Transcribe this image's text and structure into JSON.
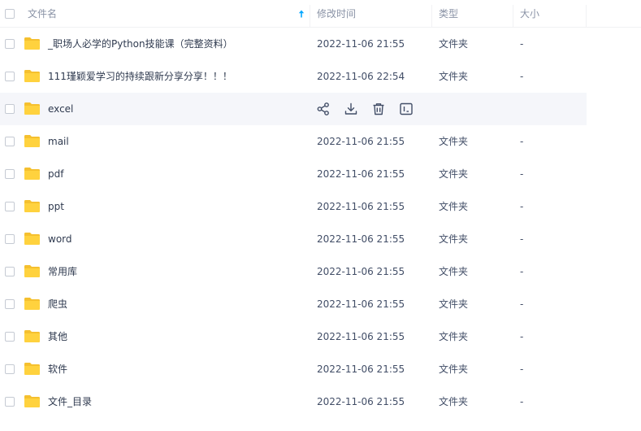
{
  "header": {
    "name": "文件名",
    "time": "修改时间",
    "type": "类型",
    "size": "大小"
  },
  "colors": {
    "folder": "#ffd23e",
    "folder_tab": "#f5c02f",
    "sort_arrow": "#06a7ff",
    "hover_row": "#f5f6fa"
  },
  "hover_actions": [
    "share-icon",
    "download-icon",
    "delete-icon",
    "rename-icon"
  ],
  "rows": [
    {
      "name": "_职场人必学的Python技能课（完整资料）",
      "time": "2022-11-06 21:55",
      "type": "文件夹",
      "size": "-"
    },
    {
      "name": "111瑾颖爱学习的持续跟新分享分享！！！",
      "time": "2022-11-06 22:54",
      "type": "文件夹",
      "size": "-"
    },
    {
      "name": "excel",
      "time": "",
      "type": "",
      "size": ""
    },
    {
      "name": "mail",
      "time": "2022-11-06 21:55",
      "type": "文件夹",
      "size": "-"
    },
    {
      "name": "pdf",
      "time": "2022-11-06 21:55",
      "type": "文件夹",
      "size": "-"
    },
    {
      "name": "ppt",
      "time": "2022-11-06 21:55",
      "type": "文件夹",
      "size": "-"
    },
    {
      "name": "word",
      "time": "2022-11-06 21:55",
      "type": "文件夹",
      "size": "-"
    },
    {
      "name": "常用库",
      "time": "2022-11-06 21:55",
      "type": "文件夹",
      "size": "-"
    },
    {
      "name": "爬虫",
      "time": "2022-11-06 21:55",
      "type": "文件夹",
      "size": "-"
    },
    {
      "name": "其他",
      "time": "2022-11-06 21:55",
      "type": "文件夹",
      "size": "-"
    },
    {
      "name": "软件",
      "time": "2022-11-06 21:55",
      "type": "文件夹",
      "size": "-"
    },
    {
      "name": "文件_目录",
      "time": "2022-11-06 21:55",
      "type": "文件夹",
      "size": "-"
    }
  ]
}
